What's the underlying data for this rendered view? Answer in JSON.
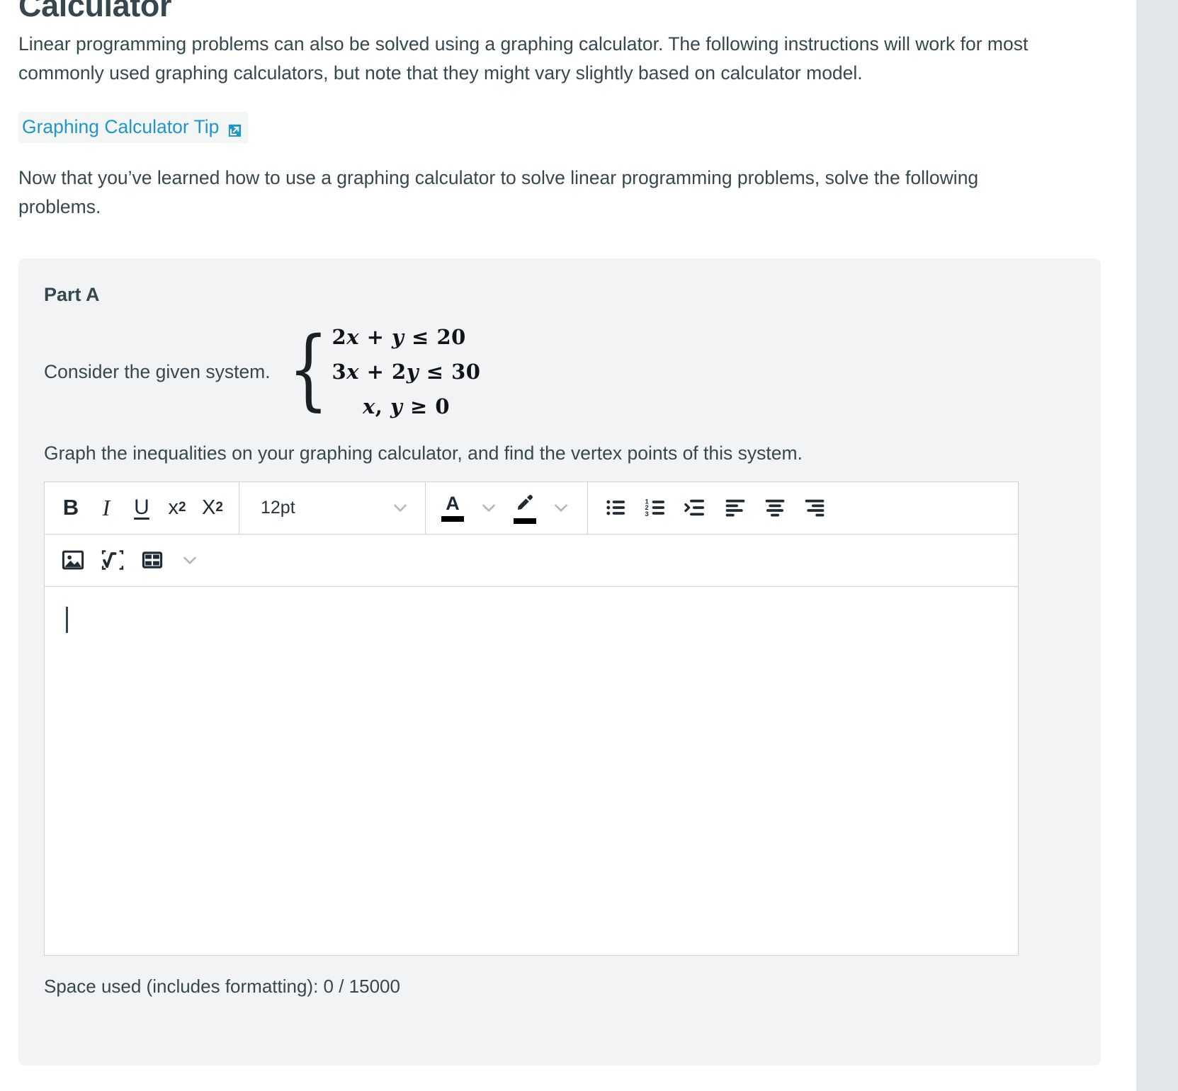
{
  "page": {
    "title": "Calculator",
    "intro_paragraph": "Linear programming problems can also be solved using a graphing calculator. The following instructions will work for most commonly used graphing calculators, but note that they might vary slightly based on calculator model.",
    "tip_link_label": "Graphing Calculator Tip",
    "tip_link_icon": "external-link-icon",
    "follow_paragraph": "Now that you’ve learned how to use a graphing calculator to solve linear programming problems, solve the following problems."
  },
  "part": {
    "label": "Part A",
    "consider_lead": "Consider the given system.",
    "system": {
      "equations": [
        "2x + y ≤ 20",
        "3x + 2y ≤ 30",
        "x, y ≥ 0"
      ],
      "eq1_coef": "2",
      "eq1_var1": "x",
      "eq1_plus": "+",
      "eq1_var2": "y",
      "eq1_rel": "≤",
      "eq1_rhs": "20",
      "eq2_coef": "3",
      "eq2_var1": "x",
      "eq2_plus": "+",
      "eq2_coef2": "2",
      "eq2_var2": "y",
      "eq2_rel": "≤",
      "eq2_rhs": "30",
      "eq3_var1": "x",
      "eq3_comma": ",",
      "eq3_var2": "y",
      "eq3_rel": "≥",
      "eq3_rhs": "0"
    },
    "instruction": "Graph the inequalities on your graphing calculator, and find the vertex points of this system."
  },
  "editor": {
    "toolbar_row1": {
      "bold_label": "B",
      "italic_label": "I",
      "underline_label": "U",
      "superscript_label": "x",
      "superscript_sup": "2",
      "subscript_label": "X",
      "subscript_sub": "2",
      "font_size_value": "12pt",
      "text_color_glyph": "A",
      "text_color_value": "#000000",
      "highlight_color_value": "#000000",
      "icons": [
        "bullet-list-icon",
        "numbered-list-icon",
        "indent-icon",
        "align-left-icon",
        "align-center-icon",
        "align-right-icon"
      ]
    },
    "toolbar_row2": {
      "icons": [
        "insert-image-icon",
        "insert-equation-icon",
        "insert-table-icon"
      ]
    },
    "body_value": "",
    "space_used": "Space used (includes formatting): 0 / 15000"
  },
  "colors": {
    "link": "#2196c9",
    "text": "#37474f",
    "card_bg": "#f1f3f5",
    "gutter": "#e2e6e8"
  }
}
